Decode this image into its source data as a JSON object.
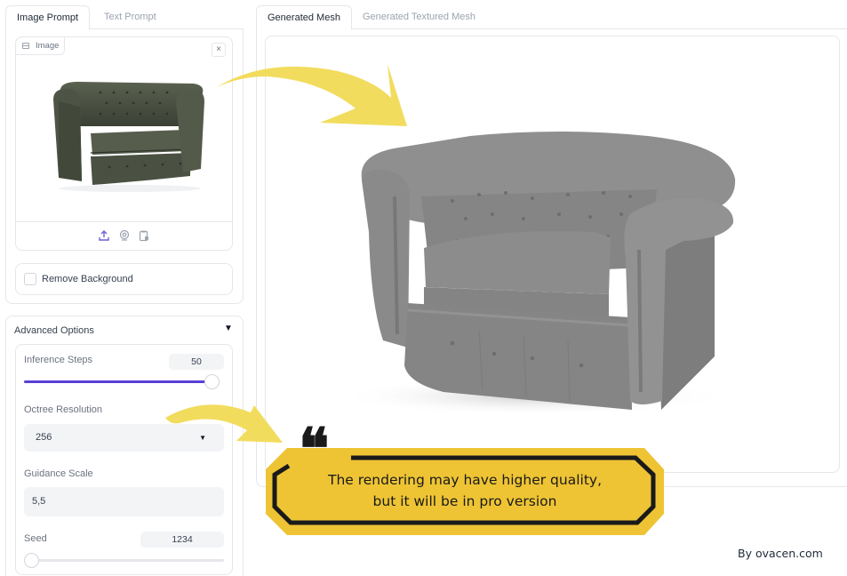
{
  "left_tabs": [
    {
      "label": "Image Prompt",
      "active": true
    },
    {
      "label": "Text Prompt",
      "active": false
    }
  ],
  "image_input": {
    "label": "Image",
    "close_label": "×",
    "source_icons": [
      "upload-icon",
      "webcam-icon",
      "clipboard-icon"
    ]
  },
  "remove_background": {
    "label": "Remove Background",
    "checked": false
  },
  "advanced": {
    "title": "Advanced Options",
    "caret": "▼",
    "inference_steps": {
      "label": "Inference Steps",
      "value": "50",
      "fraction": 0.98
    },
    "octree_resolution": {
      "label": "Octree Resolution",
      "value": "256",
      "caret": "▼"
    },
    "guidance_scale": {
      "label": "Guidance Scale",
      "value": "5,5"
    },
    "seed": {
      "label": "Seed",
      "value": "1234",
      "fraction": 0.0
    }
  },
  "right_tabs": [
    {
      "label": "Generated Mesh",
      "active": true
    },
    {
      "label": "Generated Textured Mesh",
      "active": false
    }
  ],
  "annotation": {
    "quote_mark": "❝",
    "line1": "The rendering may have higher quality,",
    "line2": "but it will be in pro version"
  },
  "watermark": "By ovacen.com",
  "colors": {
    "accent": "#5b3fd6",
    "callout_yellow": "#eec434",
    "arrow_yellow": "#f2dc5d",
    "mesh_gray": "#8a8a8a",
    "sofa_green": "#4a5142"
  }
}
